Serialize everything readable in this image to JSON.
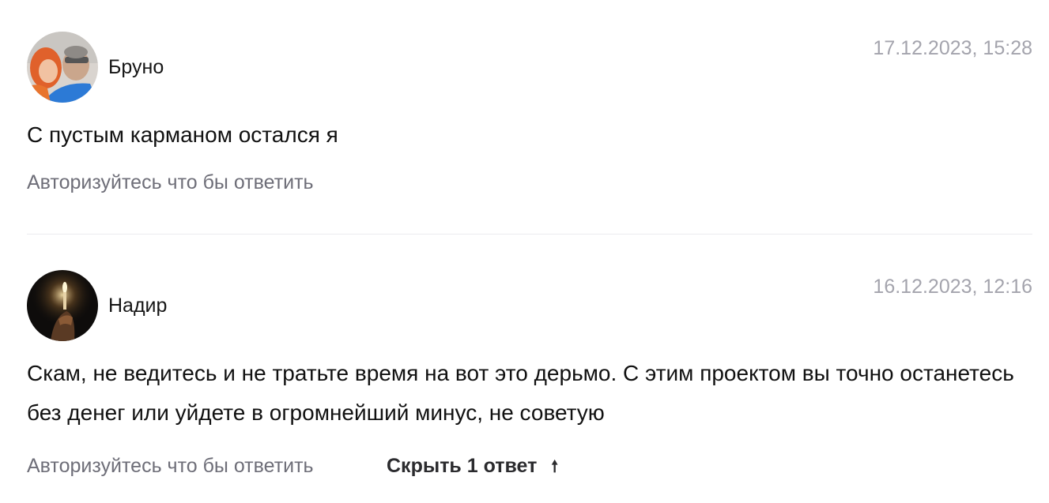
{
  "comments": [
    {
      "author": "Бруно",
      "date": "17.12.2023, 15:28",
      "avatar": "photo-avatar-couple",
      "text": "С пустым карманом остался я",
      "reply_label": "Авторизуйтесь что бы ответить"
    },
    {
      "author": "Надир",
      "date": "16.12.2023, 12:16",
      "avatar": "photo-avatar-candle",
      "text": "Скам, не ведитесь и не тратьте время на вот это дерьмо. С этим проектом вы точно останетесь без денег или уйдете в огромнейший минус, не советую",
      "reply_label": "Авторизуйтесь что бы ответить",
      "hide_replies_label": "Скрыть 1 ответ",
      "hide_replies_icon": "arrow-up-icon"
    }
  ],
  "colors": {
    "date": "#a4a4ad",
    "reply_link": "#6e6e78",
    "divider": "#ececef"
  }
}
